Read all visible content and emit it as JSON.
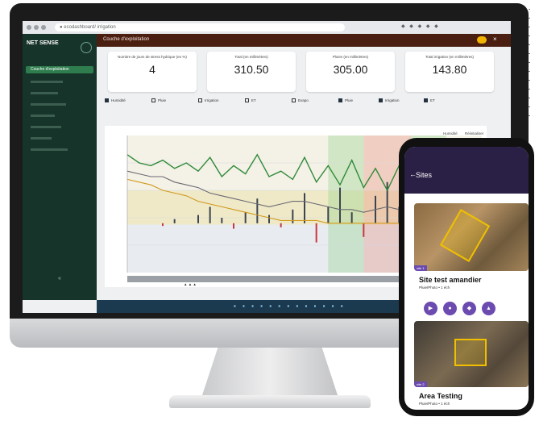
{
  "browser": {
    "url": "● ecodashboard/ irrigation",
    "extensions": "◆ ◆ ◆ ◆ ◆"
  },
  "app": {
    "title": "Couche d'exploitation",
    "user": "",
    "close": "×"
  },
  "sidebar": {
    "logo": "NET SENSE",
    "logo_sub": "",
    "items": [
      {
        "label": "Couche d'exploitation",
        "active": true
      },
      {
        "label": ""
      },
      {
        "label": ""
      },
      {
        "label": ""
      },
      {
        "label": ""
      },
      {
        "label": ""
      },
      {
        "label": ""
      },
      {
        "label": ""
      }
    ],
    "footer": "«"
  },
  "cards": [
    {
      "label": "Nombre de jours de stress hydrique (en %)",
      "value": "4"
    },
    {
      "label": "Total (en millimètres)",
      "value": "310.50"
    },
    {
      "label": "Pluies (en millimètres)",
      "value": "305.00"
    },
    {
      "label": "Total irrigation (en millimètres)",
      "value": "143.80"
    }
  ],
  "legend": [
    {
      "label": "Humidité",
      "filled": true
    },
    {
      "label": "Pluie",
      "filled": false
    },
    {
      "label": "Irrigation",
      "filled": false
    },
    {
      "label": "ET",
      "filled": false
    },
    {
      "label": "Evapo",
      "filled": false
    },
    {
      "label": "Pluie",
      "filled": true
    },
    {
      "label": "Irrigation",
      "filled": true
    },
    {
      "label": "ET",
      "filled": true
    }
  ],
  "chart_buttons": {
    "left": "Humidité",
    "right": "Réinitialiser"
  },
  "taskbar": {
    "icons": "▪ ▪ ▪ ▪ ▪ ▪ ▪ ▪ ▪ ▪ ▪ ▪ ▪",
    "status": "▲ ▲ ▲"
  },
  "phone": {
    "title": "Sites",
    "back": "←",
    "sites": [
      {
        "name": "Site test amandier",
        "tag": "site 1",
        "sub": "Pluie/Photo • 1 éch"
      },
      {
        "name": "Area Testing",
        "tag": "site 2",
        "sub": "Pluie/Photo • 1 éch"
      }
    ],
    "buttons": [
      "▶",
      "●",
      "◆",
      "▲"
    ]
  },
  "chart_data": {
    "type": "line",
    "title": "",
    "xlabel": "",
    "ylabel": "",
    "ylim": [
      0,
      100
    ],
    "x": [
      0,
      1,
      2,
      3,
      4,
      5,
      6,
      7,
      8,
      9,
      10,
      11,
      12,
      13,
      14,
      15,
      16,
      17,
      18,
      19,
      20,
      21,
      22,
      23,
      24,
      25,
      26,
      27,
      28,
      29,
      30
    ],
    "series": [
      {
        "name": "",
        "color": "#2f8a3a",
        "values": [
          86,
          80,
          78,
          82,
          76,
          80,
          74,
          84,
          70,
          78,
          72,
          86,
          70,
          74,
          68,
          84,
          66,
          78,
          64,
          82,
          62,
          76,
          60,
          78,
          64,
          74,
          58,
          72,
          60,
          66,
          62
        ]
      },
      {
        "name": "",
        "color": "#6a6a72",
        "values": [
          74,
          72,
          70,
          70,
          66,
          64,
          62,
          58,
          56,
          54,
          52,
          50,
          48,
          50,
          52,
          52,
          50,
          48,
          46,
          46,
          44,
          46,
          48,
          46,
          44,
          42,
          44,
          42,
          40,
          42,
          40
        ]
      },
      {
        "name": "",
        "color": "#d19a1c",
        "values": [
          68,
          66,
          64,
          60,
          58,
          56,
          52,
          50,
          48,
          46,
          44,
          42,
          40,
          38,
          38,
          38,
          38,
          36,
          36,
          36,
          36,
          36,
          36,
          36,
          36,
          36,
          36,
          36,
          36,
          36,
          36
        ]
      }
    ],
    "bars": [
      0,
      0,
      0,
      -2,
      3,
      0,
      6,
      12,
      4,
      -4,
      8,
      18,
      6,
      -3,
      10,
      22,
      -14,
      12,
      26,
      8,
      -10,
      20,
      30,
      12,
      -6,
      18,
      10,
      0,
      6,
      4,
      8
    ],
    "bands": [
      {
        "from": 17,
        "to": 20,
        "color": "green"
      },
      {
        "from": 20,
        "to": 24,
        "color": "red"
      },
      {
        "from": 24,
        "to": 27,
        "color": "green"
      }
    ]
  }
}
